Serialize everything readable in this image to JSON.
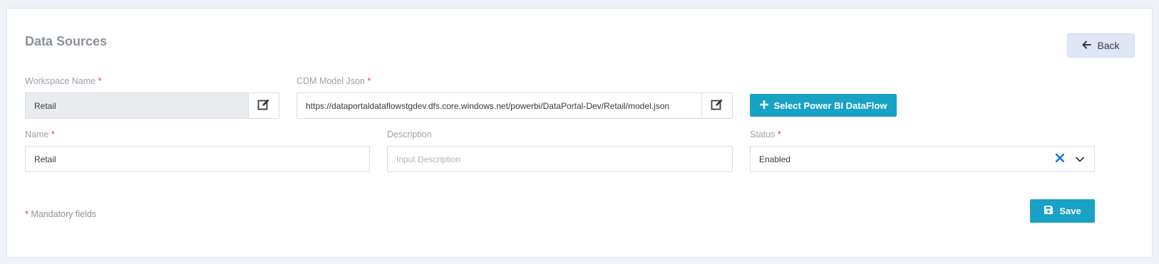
{
  "page": {
    "title": "Data Sources"
  },
  "toolbar": {
    "back_label": "Back"
  },
  "workspace": {
    "label": "Workspace Name",
    "value": "Retail"
  },
  "cdm": {
    "label": "CDM Model Json",
    "value": "https://dataportaldataflowstgdev.dfs.core.windows.net/powerbi/DataPortal-Dev/Retail/model.json"
  },
  "select_dataflow": {
    "label": "Select Power BI DataFlow"
  },
  "name": {
    "label": "Name",
    "value": "Retail"
  },
  "description": {
    "label": "Description",
    "placeholder": "Input Description",
    "value": ""
  },
  "status": {
    "label": "Status",
    "value": "Enabled"
  },
  "mandatory_note": "Mandatory fields",
  "required_marker": "*",
  "save": {
    "label": "Save"
  },
  "colors": {
    "accent": "#17a2c6",
    "required": "#e53935",
    "clear_icon": "#1a73e8"
  }
}
